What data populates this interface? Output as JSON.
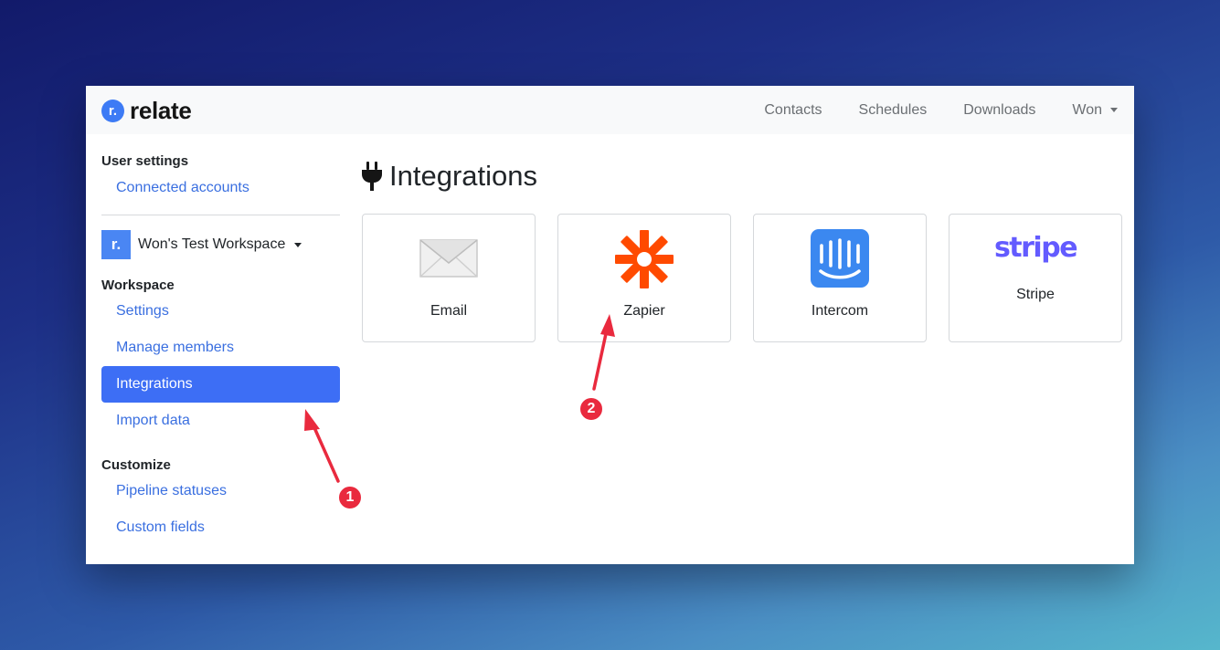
{
  "brand": {
    "logo_letter": "r.",
    "name": "relate"
  },
  "navbar": {
    "links": [
      "Contacts",
      "Schedules",
      "Downloads"
    ],
    "user": "Won"
  },
  "sidebar": {
    "user_settings_heading": "User settings",
    "connected_accounts": "Connected accounts",
    "workspace_logo": "r.",
    "workspace_name": "Won's Test Workspace",
    "workspace_heading": "Workspace",
    "workspace_items": [
      "Settings",
      "Manage members",
      "Integrations",
      "Import data"
    ],
    "active_item": "Integrations",
    "customize_heading": "Customize",
    "customize_items": [
      "Pipeline statuses",
      "Custom fields"
    ]
  },
  "main": {
    "title": "Integrations",
    "title_icon": "plug-icon",
    "integrations": [
      {
        "label": "Email",
        "icon": "envelope-icon"
      },
      {
        "label": "Zapier",
        "icon": "zapier-icon",
        "color": "#ff4a00"
      },
      {
        "label": "Intercom",
        "icon": "intercom-icon",
        "color": "#3b88f0"
      },
      {
        "label": "Stripe",
        "icon": "stripe-logo",
        "logo_text": "stripe",
        "color": "#635bff"
      }
    ]
  },
  "annotations": [
    {
      "number": "1",
      "color": "#e92a3e"
    },
    {
      "number": "2",
      "color": "#e92a3e"
    }
  ]
}
